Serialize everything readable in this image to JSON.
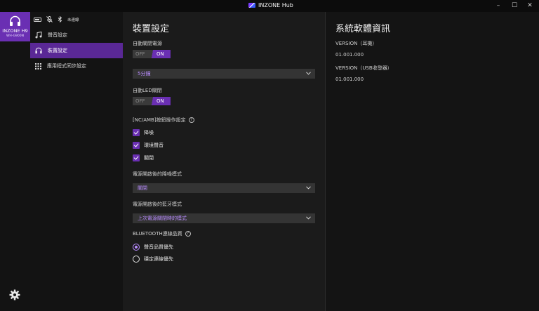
{
  "titlebar": {
    "app_title": "INZONE Hub",
    "min": "–",
    "max": "☐",
    "close": "✕"
  },
  "device": {
    "name": "INZONE H9",
    "model": "WH-G900N"
  },
  "status": {
    "connection_text": "未連線"
  },
  "nav": [
    {
      "label": "聲音設定",
      "icon": "music-note-icon"
    },
    {
      "label": "裝置設定",
      "icon": "headphones-icon"
    },
    {
      "label": "應用程式同步設定",
      "icon": "grid-icon"
    }
  ],
  "main": {
    "title": "裝置設定",
    "auto_power": {
      "label": "自動關閉電源",
      "off": "OFF",
      "on": "ON",
      "value": "ON"
    },
    "auto_power_select": "5分鐘",
    "auto_led": {
      "label": "自動LED關閉",
      "off": "OFF",
      "on": "ON",
      "value": "ON"
    },
    "nc_amb": {
      "label": "[NC/AMB]按鈕操作設定",
      "options": [
        {
          "label": "降噪",
          "checked": true
        },
        {
          "label": "環境聲音",
          "checked": true
        },
        {
          "label": "關閉",
          "checked": true
        }
      ]
    },
    "nc_on_power": {
      "label": "電源開啟後的降噪模式",
      "value": "關閉"
    },
    "bt_on_power": {
      "label": "電源開啟後的藍牙模式",
      "value": "上次電源關閉時的模式"
    },
    "bt_quality": {
      "label": "BLUETOOTH連線品質",
      "options": [
        {
          "label": "聲音品質優先",
          "selected": true
        },
        {
          "label": "穩定連線優先",
          "selected": false
        }
      ]
    }
  },
  "info": {
    "title": "系統軟體資訊",
    "headset_label": "VERSION（耳機）",
    "headset_version": "01.001.000",
    "usb_label": "VERSION（USB收發器）",
    "usb_version": "01.001.000"
  },
  "colors": {
    "accent": "#6a2fb3",
    "accent_text": "#b98cff"
  }
}
